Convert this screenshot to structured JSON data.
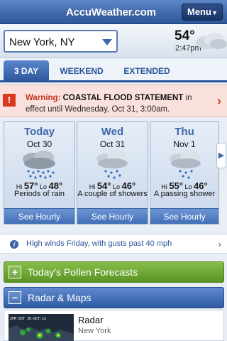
{
  "app": {
    "logo": "AccuWeather.com",
    "menu_label": "Menu"
  },
  "location": {
    "name": "New York, NY",
    "current_temp": "54°",
    "current_time": "2:47pm"
  },
  "tabs": [
    {
      "label": "3 DAY",
      "active": true
    },
    {
      "label": "WEEKEND",
      "active": false
    },
    {
      "label": "EXTENDED",
      "active": false
    }
  ],
  "warning": {
    "badge": "!",
    "label": "Warning:",
    "title": "COASTAL FLOOD STATEMENT",
    "text": " in effect until Wednesday, Oct 31, 3:00am."
  },
  "forecast": [
    {
      "name": "Today",
      "date": "Oct 30",
      "hi_label": "Hi",
      "hi": "57°",
      "lo_label": "Lo",
      "lo": "48°",
      "desc": "Periods of rain",
      "hourly": "See Hourly"
    },
    {
      "name": "Wed",
      "date": "Oct 31",
      "hi_label": "Hi",
      "hi": "54°",
      "lo_label": "Lo",
      "lo": "46°",
      "desc": "A couple of showers",
      "hourly": "See Hourly"
    },
    {
      "name": "Thu",
      "date": "Nov 1",
      "hi_label": "Hi",
      "hi": "55°",
      "lo_label": "Lo",
      "lo": "46°",
      "desc": "A passing shower",
      "hourly": "See Hourly"
    }
  ],
  "info": {
    "icon": "i",
    "text": "High winds Friday, with gusts past 40 mph"
  },
  "sections": {
    "pollen_label": "Today's Pollen Forecasts",
    "pollen_toggle": "+",
    "radar_label": "Radar & Maps",
    "radar_toggle": "−"
  },
  "radar_card": {
    "title": "Radar",
    "subtitle": "New York",
    "thumb_caption": "2PM EDT 30-OCT-12"
  },
  "colors": {
    "brand_blue": "#2b5398",
    "warning_red": "#d93a1e",
    "pollen_green": "#5b9424"
  }
}
